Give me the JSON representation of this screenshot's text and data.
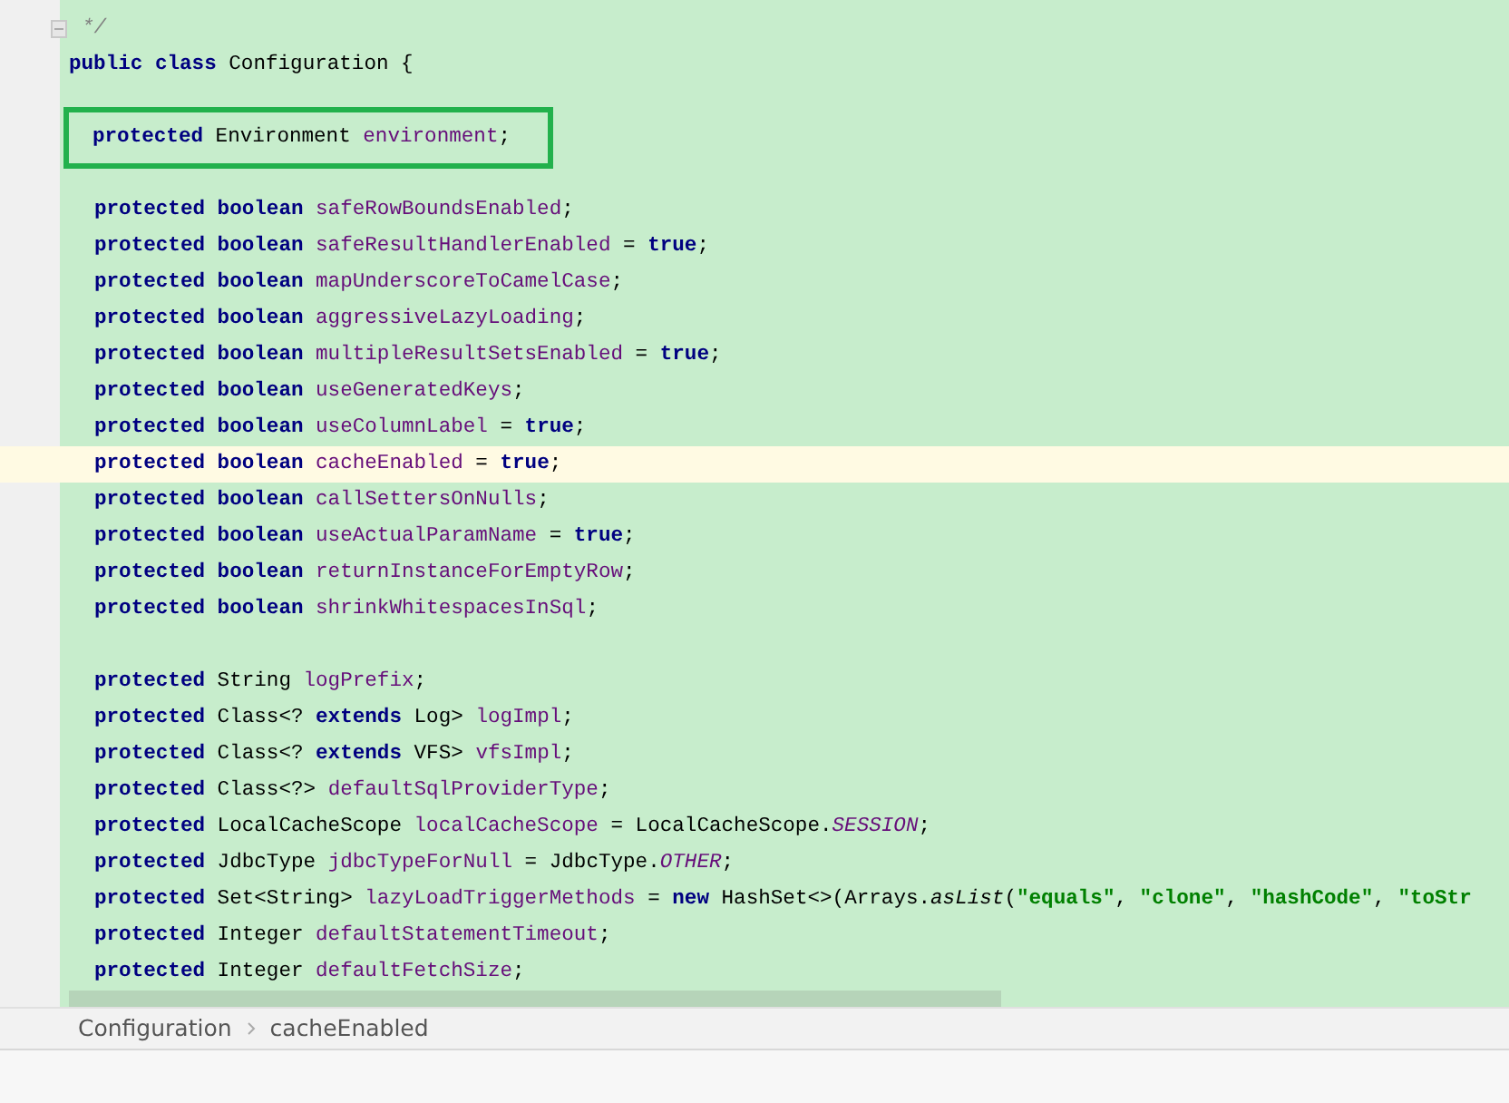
{
  "editor": {
    "lines": [
      {
        "kind": "comment",
        "fold": true,
        "tokens": [
          {
            "kind": "comment",
            "text": "*/"
          }
        ]
      },
      {
        "kind": "class",
        "tokens": [
          {
            "kind": "kw",
            "text": "public class"
          },
          {
            "kind": "plain",
            "text": " Configuration {"
          }
        ]
      },
      {
        "kind": "blank"
      },
      {
        "kind": "member",
        "boxed": true,
        "tokens": [
          {
            "kind": "kw",
            "text": "protected"
          },
          {
            "kind": "plain",
            "text": " Environment "
          },
          {
            "kind": "field",
            "text": "environment"
          },
          {
            "kind": "plain",
            "text": ";"
          }
        ]
      },
      {
        "kind": "blank"
      },
      {
        "kind": "member",
        "tokens": [
          {
            "kind": "kw",
            "text": "protected boolean"
          },
          {
            "kind": "field",
            "text": " safeRowBoundsEnabled"
          },
          {
            "kind": "plain",
            "text": ";"
          }
        ]
      },
      {
        "kind": "member",
        "tokens": [
          {
            "kind": "kw",
            "text": "protected boolean"
          },
          {
            "kind": "field",
            "text": " safeResultHandlerEnabled"
          },
          {
            "kind": "plain",
            "text": " = "
          },
          {
            "kind": "kw",
            "text": "true"
          },
          {
            "kind": "plain",
            "text": ";"
          }
        ]
      },
      {
        "kind": "member",
        "tokens": [
          {
            "kind": "kw",
            "text": "protected boolean"
          },
          {
            "kind": "field",
            "text": " mapUnderscoreToCamelCase"
          },
          {
            "kind": "plain",
            "text": ";"
          }
        ]
      },
      {
        "kind": "member",
        "tokens": [
          {
            "kind": "kw",
            "text": "protected boolean"
          },
          {
            "kind": "field",
            "text": " aggressiveLazyLoading"
          },
          {
            "kind": "plain",
            "text": ";"
          }
        ]
      },
      {
        "kind": "member",
        "tokens": [
          {
            "kind": "kw",
            "text": "protected boolean"
          },
          {
            "kind": "field",
            "text": " multipleResultSetsEnabled"
          },
          {
            "kind": "plain",
            "text": " = "
          },
          {
            "kind": "kw",
            "text": "true"
          },
          {
            "kind": "plain",
            "text": ";"
          }
        ]
      },
      {
        "kind": "member",
        "tokens": [
          {
            "kind": "kw",
            "text": "protected boolean"
          },
          {
            "kind": "field",
            "text": " useGeneratedKeys"
          },
          {
            "kind": "plain",
            "text": ";"
          }
        ]
      },
      {
        "kind": "member",
        "tokens": [
          {
            "kind": "kw",
            "text": "protected boolean"
          },
          {
            "kind": "field",
            "text": " useColumnLabel"
          },
          {
            "kind": "plain",
            "text": " = "
          },
          {
            "kind": "kw",
            "text": "true"
          },
          {
            "kind": "plain",
            "text": ";"
          }
        ]
      },
      {
        "kind": "member",
        "current": true,
        "tokens": [
          {
            "kind": "kw",
            "text": "protected boolean"
          },
          {
            "kind": "field",
            "text": " cacheEnabled"
          },
          {
            "kind": "plain",
            "text": " = "
          },
          {
            "kind": "kw",
            "text": "true"
          },
          {
            "kind": "plain",
            "text": ";"
          }
        ]
      },
      {
        "kind": "member",
        "tokens": [
          {
            "kind": "kw",
            "text": "protected boolean"
          },
          {
            "kind": "field",
            "text": " callSettersOnNulls"
          },
          {
            "kind": "plain",
            "text": ";"
          }
        ]
      },
      {
        "kind": "member",
        "tokens": [
          {
            "kind": "kw",
            "text": "protected boolean"
          },
          {
            "kind": "field",
            "text": " useActualParamName"
          },
          {
            "kind": "plain",
            "text": " = "
          },
          {
            "kind": "kw",
            "text": "true"
          },
          {
            "kind": "plain",
            "text": ";"
          }
        ]
      },
      {
        "kind": "member",
        "tokens": [
          {
            "kind": "kw",
            "text": "protected boolean"
          },
          {
            "kind": "field",
            "text": " returnInstanceForEmptyRow"
          },
          {
            "kind": "plain",
            "text": ";"
          }
        ]
      },
      {
        "kind": "member",
        "tokens": [
          {
            "kind": "kw",
            "text": "protected boolean"
          },
          {
            "kind": "field",
            "text": " shrinkWhitespacesInSql"
          },
          {
            "kind": "plain",
            "text": ";"
          }
        ]
      },
      {
        "kind": "blank"
      },
      {
        "kind": "member",
        "tokens": [
          {
            "kind": "kw",
            "text": "protected"
          },
          {
            "kind": "plain",
            "text": " String "
          },
          {
            "kind": "field",
            "text": "logPrefix"
          },
          {
            "kind": "plain",
            "text": ";"
          }
        ]
      },
      {
        "kind": "member",
        "tokens": [
          {
            "kind": "kw",
            "text": "protected"
          },
          {
            "kind": "plain",
            "text": " Class<? "
          },
          {
            "kind": "kw",
            "text": "extends"
          },
          {
            "kind": "plain",
            "text": " Log> "
          },
          {
            "kind": "field",
            "text": "logImpl"
          },
          {
            "kind": "plain",
            "text": ";"
          }
        ]
      },
      {
        "kind": "member",
        "tokens": [
          {
            "kind": "kw",
            "text": "protected"
          },
          {
            "kind": "plain",
            "text": " Class<? "
          },
          {
            "kind": "kw",
            "text": "extends"
          },
          {
            "kind": "plain",
            "text": " VFS> "
          },
          {
            "kind": "field",
            "text": "vfsImpl"
          },
          {
            "kind": "plain",
            "text": ";"
          }
        ]
      },
      {
        "kind": "member",
        "tokens": [
          {
            "kind": "kw",
            "text": "protected"
          },
          {
            "kind": "plain",
            "text": " Class<?> "
          },
          {
            "kind": "field",
            "text": "defaultSqlProviderType"
          },
          {
            "kind": "plain",
            "text": ";"
          }
        ]
      },
      {
        "kind": "member",
        "tokens": [
          {
            "kind": "kw",
            "text": "protected"
          },
          {
            "kind": "plain",
            "text": " LocalCacheScope "
          },
          {
            "kind": "field",
            "text": "localCacheScope"
          },
          {
            "kind": "plain",
            "text": " = LocalCacheScope."
          },
          {
            "kind": "const",
            "text": "SESSION"
          },
          {
            "kind": "plain",
            "text": ";"
          }
        ]
      },
      {
        "kind": "member",
        "tokens": [
          {
            "kind": "kw",
            "text": "protected"
          },
          {
            "kind": "plain",
            "text": " JdbcType "
          },
          {
            "kind": "field",
            "text": "jdbcTypeForNull"
          },
          {
            "kind": "plain",
            "text": " = JdbcType."
          },
          {
            "kind": "const",
            "text": "OTHER"
          },
          {
            "kind": "plain",
            "text": ";"
          }
        ]
      },
      {
        "kind": "member",
        "tokens": [
          {
            "kind": "kw",
            "text": "protected"
          },
          {
            "kind": "plain",
            "text": " Set<String> "
          },
          {
            "kind": "field",
            "text": "lazyLoadTriggerMethods"
          },
          {
            "kind": "plain",
            "text": " = "
          },
          {
            "kind": "kw",
            "text": "new"
          },
          {
            "kind": "plain",
            "text": " HashSet<>(Arrays."
          },
          {
            "kind": "call",
            "text": "asList"
          },
          {
            "kind": "plain",
            "text": "("
          },
          {
            "kind": "str",
            "text": "\"equals\""
          },
          {
            "kind": "plain",
            "text": ", "
          },
          {
            "kind": "str",
            "text": "\"clone\""
          },
          {
            "kind": "plain",
            "text": ", "
          },
          {
            "kind": "str",
            "text": "\"hashCode\""
          },
          {
            "kind": "plain",
            "text": ", "
          },
          {
            "kind": "str",
            "text": "\"toStr"
          }
        ]
      },
      {
        "kind": "member",
        "tokens": [
          {
            "kind": "kw",
            "text": "protected"
          },
          {
            "kind": "plain",
            "text": " Integer "
          },
          {
            "kind": "field",
            "text": "defaultStatementTimeout"
          },
          {
            "kind": "plain",
            "text": ";"
          }
        ]
      },
      {
        "kind": "member",
        "tokens": [
          {
            "kind": "kw",
            "text": "protected"
          },
          {
            "kind": "plain",
            "text": " Integer "
          },
          {
            "kind": "field",
            "text": "defaultFetchSize"
          },
          {
            "kind": "plain",
            "text": ";"
          }
        ]
      }
    ]
  },
  "breadcrumb": [
    {
      "text": "Configuration"
    },
    {
      "text": "cacheEnabled"
    }
  ]
}
